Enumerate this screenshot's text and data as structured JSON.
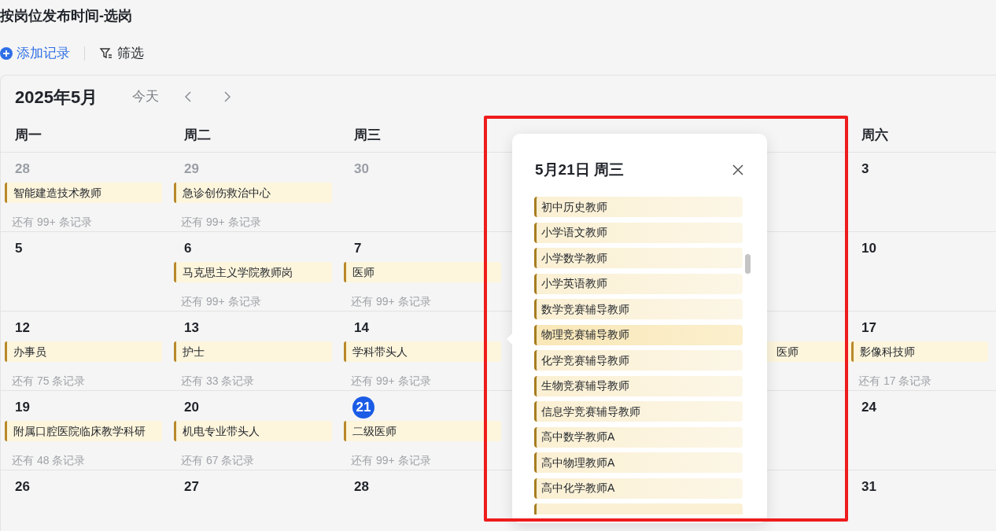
{
  "page_title": "按岗位发布时间-选岗",
  "toolbar": {
    "add_label": "添加记录",
    "filter_label": "筛选"
  },
  "calendar": {
    "month": "2025年5月",
    "today_label": "今天",
    "weekdays": [
      "周一",
      "周二",
      "周三",
      "周六"
    ],
    "weeks": [
      {
        "days": [
          {
            "date": "28",
            "other_month": true,
            "events": [
              "智能建造技术教师"
            ],
            "more": "还有 99+ 条记录"
          },
          {
            "date": "29",
            "other_month": true,
            "events": [
              "急诊创伤救治中心"
            ],
            "more": "还有 99+ 条记录"
          },
          {
            "date": "30",
            "other_month": true
          },
          {
            "date": "3",
            "other_month": false
          }
        ]
      },
      {
        "days": [
          {
            "date": "5",
            "other_month": false
          },
          {
            "date": "6",
            "other_month": false,
            "events": [
              "马克思主义学院教师岗"
            ],
            "more": "还有 99+ 条记录"
          },
          {
            "date": "7",
            "other_month": false,
            "events": [
              "医师"
            ],
            "more": "还有 99+ 条记录"
          },
          {
            "date": "10",
            "other_month": false
          }
        ]
      },
      {
        "days": [
          {
            "date": "12",
            "other_month": false,
            "events": [
              "办事员"
            ],
            "more": "还有 75 条记录"
          },
          {
            "date": "13",
            "other_month": false,
            "events": [
              "护士"
            ],
            "more": "还有 33 条记录"
          },
          {
            "date": "14",
            "other_month": false,
            "events": [
              "学科带头人"
            ],
            "more": "还有 99+ 条记录"
          },
          {
            "covered": true,
            "events": [
              "医师"
            ]
          },
          {
            "date": "17",
            "other_month": false,
            "events": [
              "影像科技师"
            ],
            "more": "还有 17 条记录"
          }
        ]
      },
      {
        "days": [
          {
            "date": "19",
            "other_month": false,
            "events": [
              "附属口腔医院临床教学科研"
            ],
            "more": "还有 48 条记录"
          },
          {
            "date": "20",
            "other_month": false,
            "events": [
              "机电专业带头人"
            ],
            "more": "还有 67 条记录"
          },
          {
            "date": "21",
            "other_month": false,
            "today": true,
            "events": [
              "二级医师"
            ],
            "more": "还有 99+ 条记录"
          },
          {
            "date": "24",
            "other_month": false
          }
        ]
      },
      {
        "days": [
          {
            "date": "26",
            "other_month": false
          },
          {
            "date": "27",
            "other_month": false
          },
          {
            "date": "28",
            "other_month": false
          },
          {
            "date": "31",
            "other_month": false
          }
        ]
      }
    ]
  },
  "popover": {
    "title": "5月21日 周三",
    "items": [
      {
        "label": "初中历史教师",
        "hovered": false
      },
      {
        "label": "小学语文教师",
        "hovered": false
      },
      {
        "label": "小学数学教师",
        "hovered": false
      },
      {
        "label": "小学英语教师",
        "hovered": false
      },
      {
        "label": "数学竞赛辅导教师",
        "hovered": false
      },
      {
        "label": "物理竞赛辅导教师",
        "hovered": true
      },
      {
        "label": "化学竞赛辅导教师",
        "hovered": false
      },
      {
        "label": "生物竞赛辅导教师",
        "hovered": false
      },
      {
        "label": "信息学竞赛辅导教师",
        "hovered": false
      },
      {
        "label": "高中数学教师A",
        "hovered": false
      },
      {
        "label": "高中物理教师A",
        "hovered": false
      },
      {
        "label": "高中化学教师A",
        "hovered": false
      }
    ]
  }
}
